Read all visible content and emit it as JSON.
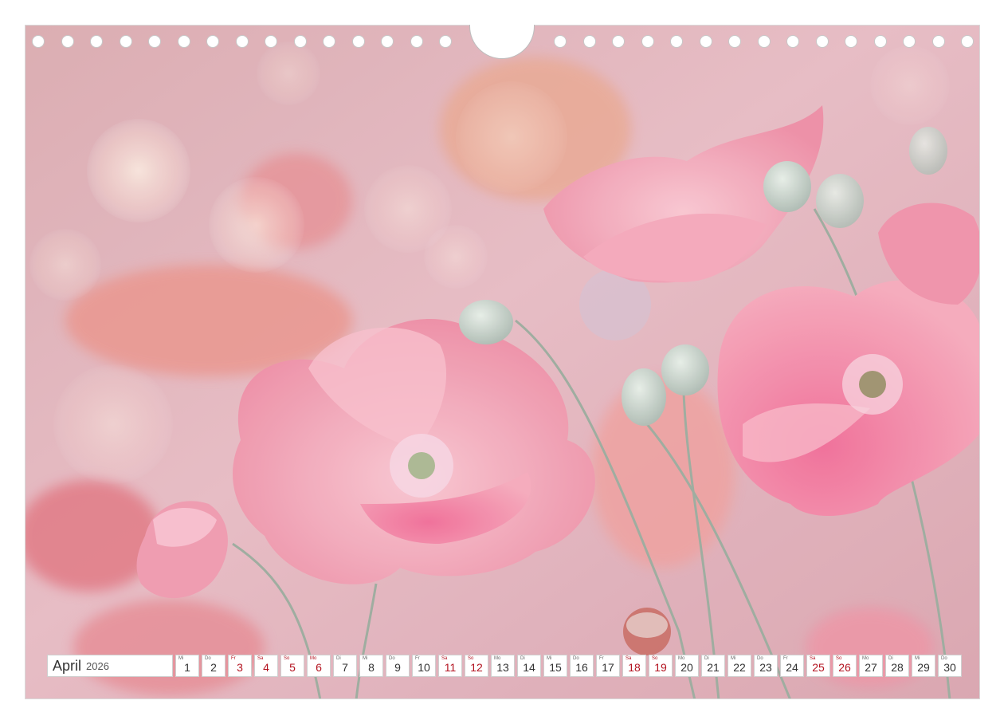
{
  "calendar": {
    "month": "April",
    "year": "2026",
    "days": [
      {
        "wd": "Mi",
        "num": "1",
        "we": false
      },
      {
        "wd": "Do",
        "num": "2",
        "we": false
      },
      {
        "wd": "Fr",
        "num": "3",
        "we": true
      },
      {
        "wd": "Sa",
        "num": "4",
        "we": true
      },
      {
        "wd": "So",
        "num": "5",
        "we": true
      },
      {
        "wd": "Mo",
        "num": "6",
        "we": true
      },
      {
        "wd": "Di",
        "num": "7",
        "we": false
      },
      {
        "wd": "Mi",
        "num": "8",
        "we": false
      },
      {
        "wd": "Do",
        "num": "9",
        "we": false
      },
      {
        "wd": "Fr",
        "num": "10",
        "we": false
      },
      {
        "wd": "Sa",
        "num": "11",
        "we": true
      },
      {
        "wd": "So",
        "num": "12",
        "we": true
      },
      {
        "wd": "Mo",
        "num": "13",
        "we": false
      },
      {
        "wd": "Di",
        "num": "14",
        "we": false
      },
      {
        "wd": "Mi",
        "num": "15",
        "we": false
      },
      {
        "wd": "Do",
        "num": "16",
        "we": false
      },
      {
        "wd": "Fr",
        "num": "17",
        "we": false
      },
      {
        "wd": "Sa",
        "num": "18",
        "we": true
      },
      {
        "wd": "So",
        "num": "19",
        "we": true
      },
      {
        "wd": "Mo",
        "num": "20",
        "we": false
      },
      {
        "wd": "Di",
        "num": "21",
        "we": false
      },
      {
        "wd": "Mi",
        "num": "22",
        "we": false
      },
      {
        "wd": "Do",
        "num": "23",
        "we": false
      },
      {
        "wd": "Fr",
        "num": "24",
        "we": false
      },
      {
        "wd": "Sa",
        "num": "25",
        "we": true
      },
      {
        "wd": "So",
        "num": "26",
        "we": true
      },
      {
        "wd": "Mo",
        "num": "27",
        "we": false
      },
      {
        "wd": "Di",
        "num": "28",
        "we": false
      },
      {
        "wd": "Mi",
        "num": "29",
        "we": false
      },
      {
        "wd": "Do",
        "num": "30",
        "we": false
      }
    ]
  },
  "colors": {
    "weekend": "#b3121f",
    "petal": "#f3a3b4",
    "petal_deep": "#e45a86",
    "background": "#e7b7bf"
  },
  "photo": {
    "subject": "pink-poppies-photo"
  }
}
